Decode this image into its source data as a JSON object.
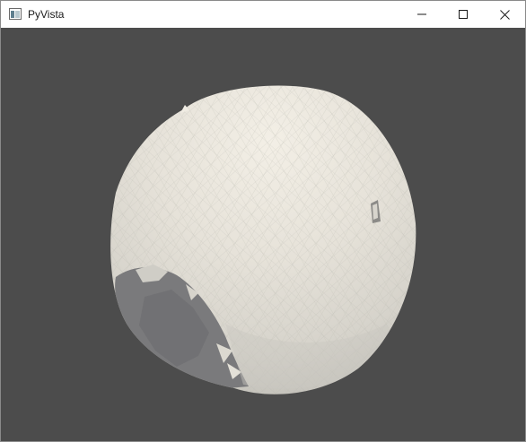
{
  "window": {
    "title": "PyVista",
    "icon": "pyvista-window-icon",
    "controls": {
      "minimize": "minimize-icon",
      "maximize": "maximize-icon",
      "close": "close-icon"
    }
  },
  "viewport": {
    "background_color": "#4c4c4c",
    "mesh_color": "#e8e4db",
    "shadow_color": "#77777a",
    "object": "sphere-mesh"
  }
}
